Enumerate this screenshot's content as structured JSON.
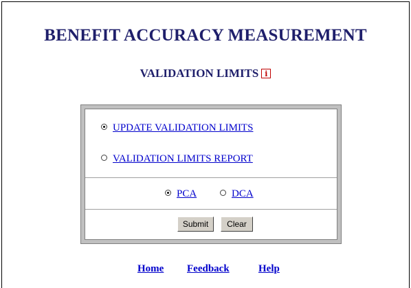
{
  "header": {
    "title": "BENEFIT ACCURACY MEASUREMENT",
    "subtitle": "VALIDATION LIMITS",
    "info_icon_glyph": "i"
  },
  "options": {
    "update_label": "UPDATE VALIDATION LIMITS",
    "update_selected": true,
    "report_label": "VALIDATION LIMITS REPORT",
    "report_selected": false
  },
  "type_options": {
    "pca_label": "PCA",
    "pca_selected": true,
    "dca_label": "DCA",
    "dca_selected": false
  },
  "buttons": {
    "submit_label": "Submit",
    "clear_label": "Clear"
  },
  "footer_links": {
    "home": "Home",
    "feedback": "Feedback",
    "help": "Help"
  },
  "colors": {
    "title": "#1f1f6b",
    "link": "#0000cc",
    "info_icon": "#c00000",
    "panel_border": "#c0c0c0"
  }
}
